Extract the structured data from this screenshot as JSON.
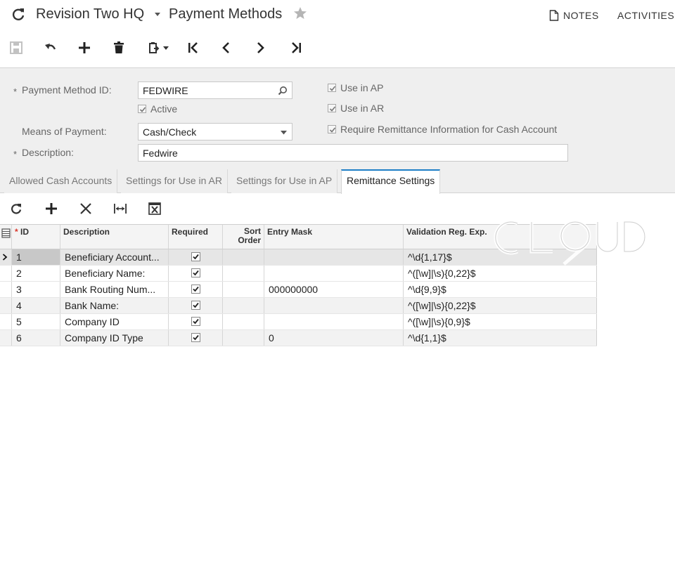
{
  "header": {
    "company": "Revision Two HQ",
    "screen_title": "Payment Methods",
    "notes_label": "NOTES",
    "activities_label": "ACTIVITIES"
  },
  "form": {
    "payment_method_id_label": "Payment Method ID:",
    "payment_method_id_value": "FEDWIRE",
    "active_label": "Active",
    "active_checked": true,
    "means_of_payment_label": "Means of Payment:",
    "means_of_payment_value": "Cash/Check",
    "description_label": "Description:",
    "description_value": "Fedwire",
    "use_in_ap_label": "Use in AP",
    "use_in_ap_checked": true,
    "use_in_ar_label": "Use in AR",
    "use_in_ar_checked": true,
    "require_remittance_label": "Require Remittance Information for Cash Account",
    "require_remittance_checked": true,
    "required_mark": "*"
  },
  "tabs": [
    {
      "label": "Allowed Cash Accounts",
      "active": false
    },
    {
      "label": "Settings for Use in AR",
      "active": false
    },
    {
      "label": "Settings for Use in AP",
      "active": false
    },
    {
      "label": "Remittance Settings",
      "active": true
    }
  ],
  "grid": {
    "columns": {
      "id": "ID",
      "id_required_mark": "*",
      "description": "Description",
      "required": "Required",
      "sort_order_line1": "Sort",
      "sort_order_line2": "Order",
      "entry_mask": "Entry Mask",
      "validation": "Validation Reg. Exp."
    },
    "rows": [
      {
        "id": "1",
        "description": "Beneficiary Account...",
        "required": true,
        "sort_order": "",
        "entry_mask": "",
        "validation": "^\\d{1,17}$"
      },
      {
        "id": "2",
        "description": "Beneficiary Name:",
        "required": true,
        "sort_order": "",
        "entry_mask": "",
        "validation": "^([\\w]|\\s){0,22}$"
      },
      {
        "id": "3",
        "description": "Bank Routing Num...",
        "required": true,
        "sort_order": "",
        "entry_mask": "000000000",
        "validation": "^\\d{9,9}$"
      },
      {
        "id": "4",
        "description": "Bank Name:",
        "required": true,
        "sort_order": "",
        "entry_mask": "",
        "validation": "^([\\w]|\\s){0,22}$"
      },
      {
        "id": "5",
        "description": "Company ID",
        "required": true,
        "sort_order": "",
        "entry_mask": "",
        "validation": "^([\\w]|\\s){0,9}$"
      },
      {
        "id": "6",
        "description": "Company ID Type",
        "required": true,
        "sort_order": "",
        "entry_mask": "0",
        "validation": "^\\d{1,1}$"
      }
    ]
  },
  "colors": {
    "accent": "#1e7fc6",
    "form_background": "#efefef",
    "alt_row": "#f2f2f2"
  },
  "icons": {
    "refresh": "refresh-icon",
    "favorite": "star-icon",
    "notes": "document-icon",
    "save": "save-icon",
    "undo": "undo-icon",
    "add": "plus-icon",
    "delete": "trash-icon",
    "clipboard": "clipboard-icon",
    "first": "first-record-icon",
    "previous": "previous-icon",
    "next": "next-icon",
    "last": "last-record-icon",
    "grid_refresh": "refresh-icon",
    "grid_add": "plus-icon",
    "grid_delete": "close-icon",
    "fit_columns": "fit-columns-icon",
    "export_excel": "excel-icon"
  }
}
